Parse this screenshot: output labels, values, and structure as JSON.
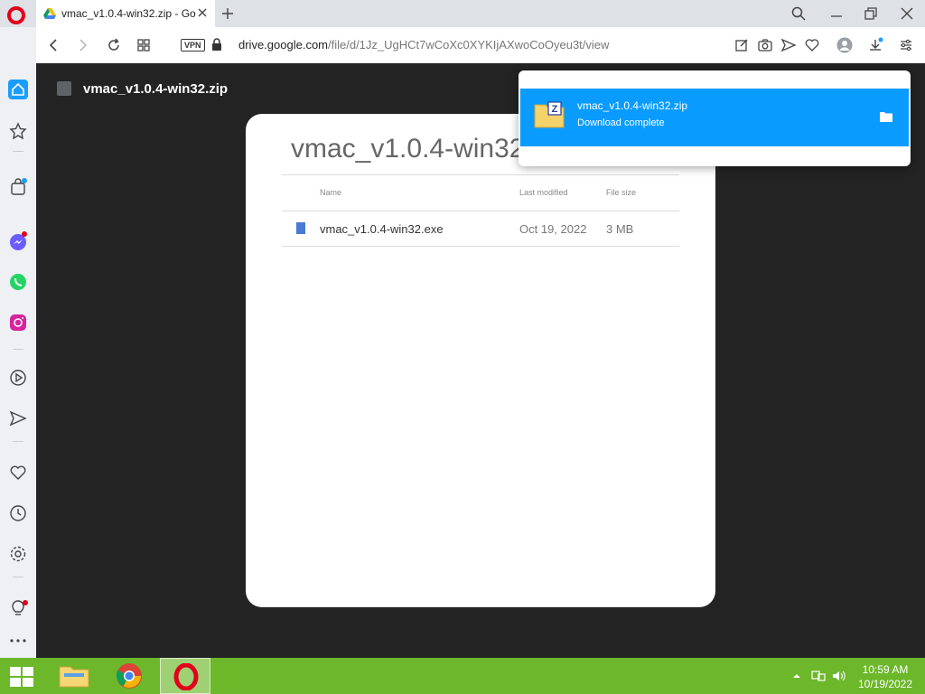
{
  "tab": {
    "title": "vmac_v1.0.4-win32.zip - Go"
  },
  "address": {
    "vpn_label": "VPN",
    "url_domain": "drive.google.com",
    "url_path": "/file/d/1Jz_UgHCt7wCoXc0XYKIjAXwoCoOyeu3t/view"
  },
  "drive": {
    "file_title": "vmac_v1.0.4-win32.zip",
    "preview_title": "vmac_v1.0.4-win32",
    "columns": {
      "name": "Name",
      "modified": "Last modified",
      "size": "File size"
    },
    "rows": [
      {
        "name": "vmac_v1.0.4-win32.exe",
        "modified": "Oct 19, 2022",
        "size": "3 MB"
      }
    ]
  },
  "download": {
    "filename": "vmac_v1.0.4-win32.zip",
    "status": "Download complete"
  },
  "taskbar": {
    "time": "10:59 AM",
    "date": "10/19/2022"
  },
  "colors": {
    "accent": "#0a9bff",
    "opera_red": "#e3001b",
    "taskbar": "#6cb72a",
    "content_bg": "#232323"
  },
  "icons": {
    "sidebar": [
      "home-icon",
      "star-icon",
      "shopping-bag-icon",
      "messenger-icon",
      "whatsapp-icon",
      "instagram-icon",
      "player-icon",
      "send-icon",
      "heart-icon",
      "history-icon",
      "settings-icon",
      "lightbulb-icon",
      "more-icon"
    ],
    "toolbar": [
      "edit-icon",
      "camera-icon",
      "send-icon",
      "heart-icon",
      "profile-icon",
      "download-icon",
      "easy-setup-icon"
    ]
  }
}
